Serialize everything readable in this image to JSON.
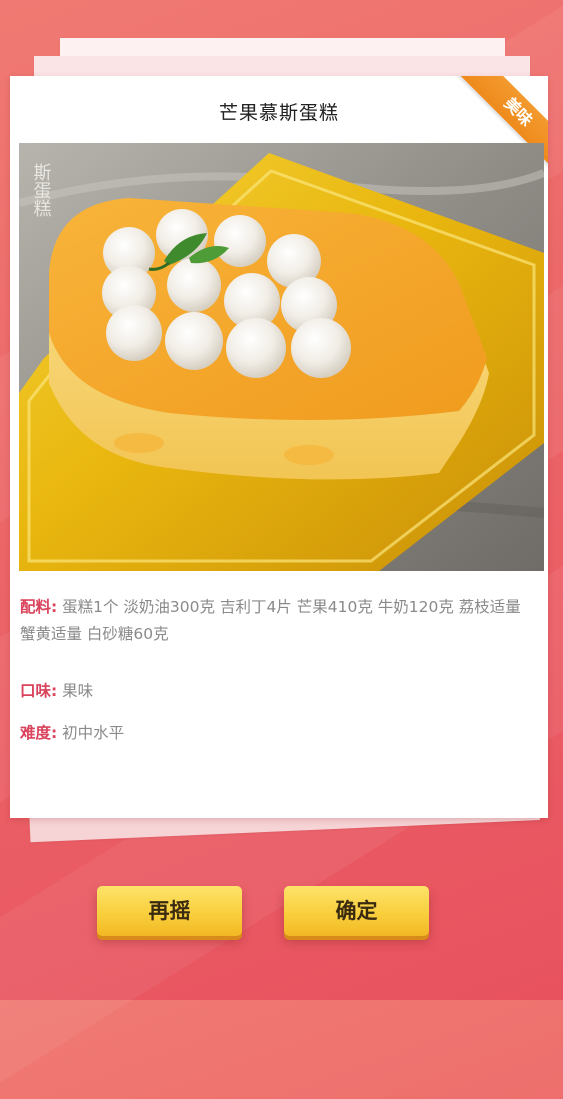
{
  "card": {
    "title": "芒果慕斯蛋糕",
    "ribbon": "美味",
    "photo_watermark": "斯蛋糕"
  },
  "details": {
    "ingredients_label": "配料:",
    "ingredients": "蛋糕1个  淡奶油300克  吉利丁4片  芒果410克  牛奶120克  荔枝适量  蟹黄适量  白砂糖60克",
    "taste_label": "口味:",
    "taste": "果味",
    "difficulty_label": "难度:",
    "difficulty": "初中水平"
  },
  "buttons": {
    "reshake": "再摇",
    "confirm": "确定"
  },
  "colors": {
    "background": "#ec6668",
    "label_red": "#d9435b",
    "ribbon_orange": "#f39a2e",
    "button_yellow": "#f9cf3d"
  }
}
